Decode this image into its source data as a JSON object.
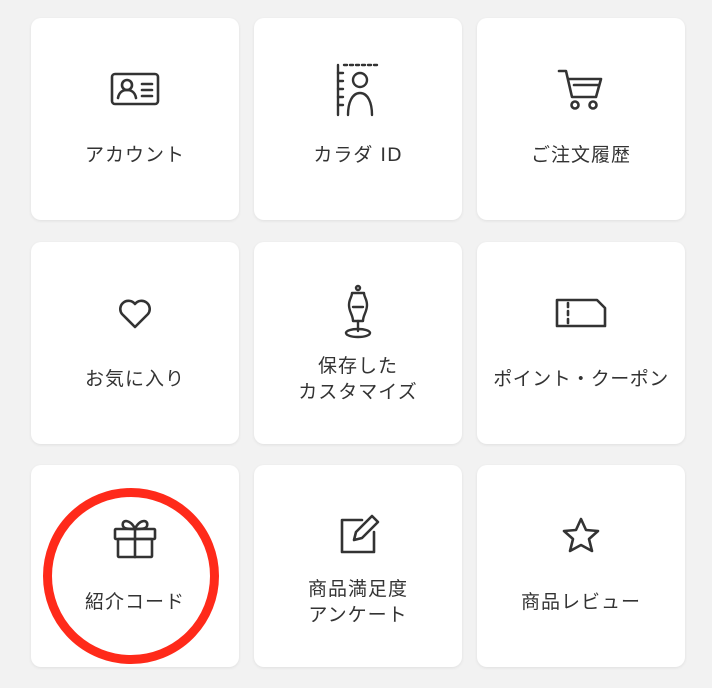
{
  "menu": {
    "tiles": [
      {
        "icon": "id-card-icon",
        "label": "アカウント"
      },
      {
        "icon": "body-measure-icon",
        "label": "カラダ ID"
      },
      {
        "icon": "cart-icon",
        "label": "ご注文履歴"
      },
      {
        "icon": "heart-icon",
        "label": "お気に入り"
      },
      {
        "icon": "dress-form-icon",
        "label_line1": "保存した",
        "label_line2": "カスタマイズ"
      },
      {
        "icon": "ticket-icon",
        "label": "ポイント・クーポン"
      },
      {
        "icon": "gift-icon",
        "label": "紹介コード"
      },
      {
        "icon": "edit-icon",
        "label_line1": "商品満足度",
        "label_line2": "アンケート"
      },
      {
        "icon": "star-icon",
        "label": "商品レビュー"
      }
    ]
  },
  "highlight": {
    "color": "#ff2a1a",
    "target": "紹介コード"
  },
  "colors": {
    "background": "#f2f2f2",
    "tile": "#ffffff",
    "text": "#333333"
  }
}
